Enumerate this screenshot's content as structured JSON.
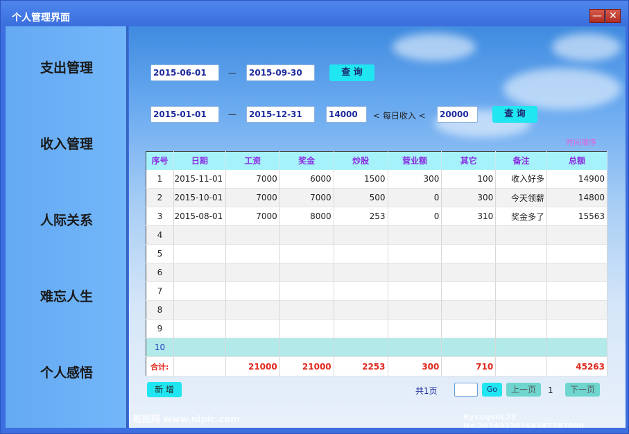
{
  "window": {
    "title": "个人管理界面",
    "minimize": "—",
    "close": "✕"
  },
  "sidebar": {
    "items": [
      {
        "label": "支出管理"
      },
      {
        "label": "收入管理"
      },
      {
        "label": "人际关系"
      },
      {
        "label": "难忘人生"
      },
      {
        "label": "个人感悟"
      }
    ]
  },
  "query1": {
    "start": "2015-06-01",
    "sep": "—",
    "end": "2015-09-30",
    "button": "查 询"
  },
  "query2": {
    "start": "2015-01-01",
    "sep": "—",
    "end": "2015-12-31",
    "min": "14000",
    "daily_label": "< 每日收入 <",
    "max": "20000",
    "button": "查 询"
  },
  "pink_label": "时间顺序",
  "table": {
    "headers": [
      "序号",
      "日期",
      "工资",
      "奖金",
      "炒股",
      "营业额",
      "其它",
      "备注",
      "总额"
    ],
    "rows": [
      [
        "1",
        "2015-11-01",
        "7000",
        "6000",
        "1500",
        "300",
        "100",
        "收入好多",
        "14900"
      ],
      [
        "2",
        "2015-10-01",
        "7000",
        "7000",
        "500",
        "0",
        "300",
        "今天领薪",
        "14800"
      ],
      [
        "3",
        "2015-08-01",
        "7000",
        "8000",
        "253",
        "0",
        "310",
        "奖金多了",
        "15563"
      ],
      [
        "4",
        "",
        "",
        "",
        "",
        "",
        "",
        "",
        ""
      ],
      [
        "5",
        "",
        "",
        "",
        "",
        "",
        "",
        "",
        ""
      ],
      [
        "6",
        "",
        "",
        "",
        "",
        "",
        "",
        "",
        ""
      ],
      [
        "7",
        "",
        "",
        "",
        "",
        "",
        "",
        "",
        ""
      ],
      [
        "8",
        "",
        "",
        "",
        "",
        "",
        "",
        "",
        ""
      ],
      [
        "9",
        "",
        "",
        "",
        "",
        "",
        "",
        "",
        ""
      ],
      [
        "10",
        "",
        "",
        "",
        "",
        "",
        "",
        "",
        ""
      ]
    ],
    "total": [
      "合计:",
      "",
      "21000",
      "21000",
      "2253",
      "300",
      "710",
      "",
      "45263"
    ]
  },
  "footer": {
    "add_button": "新 增",
    "total_pages": "共1页",
    "page_input": "",
    "go_button": "Go",
    "prev_button": "上一页",
    "current_page": "1",
    "next_button": "下一页"
  },
  "watermark": {
    "left": "昵图网 www.nipic.com",
    "right": "ByxuqunL28 No.20140320164347387000"
  }
}
